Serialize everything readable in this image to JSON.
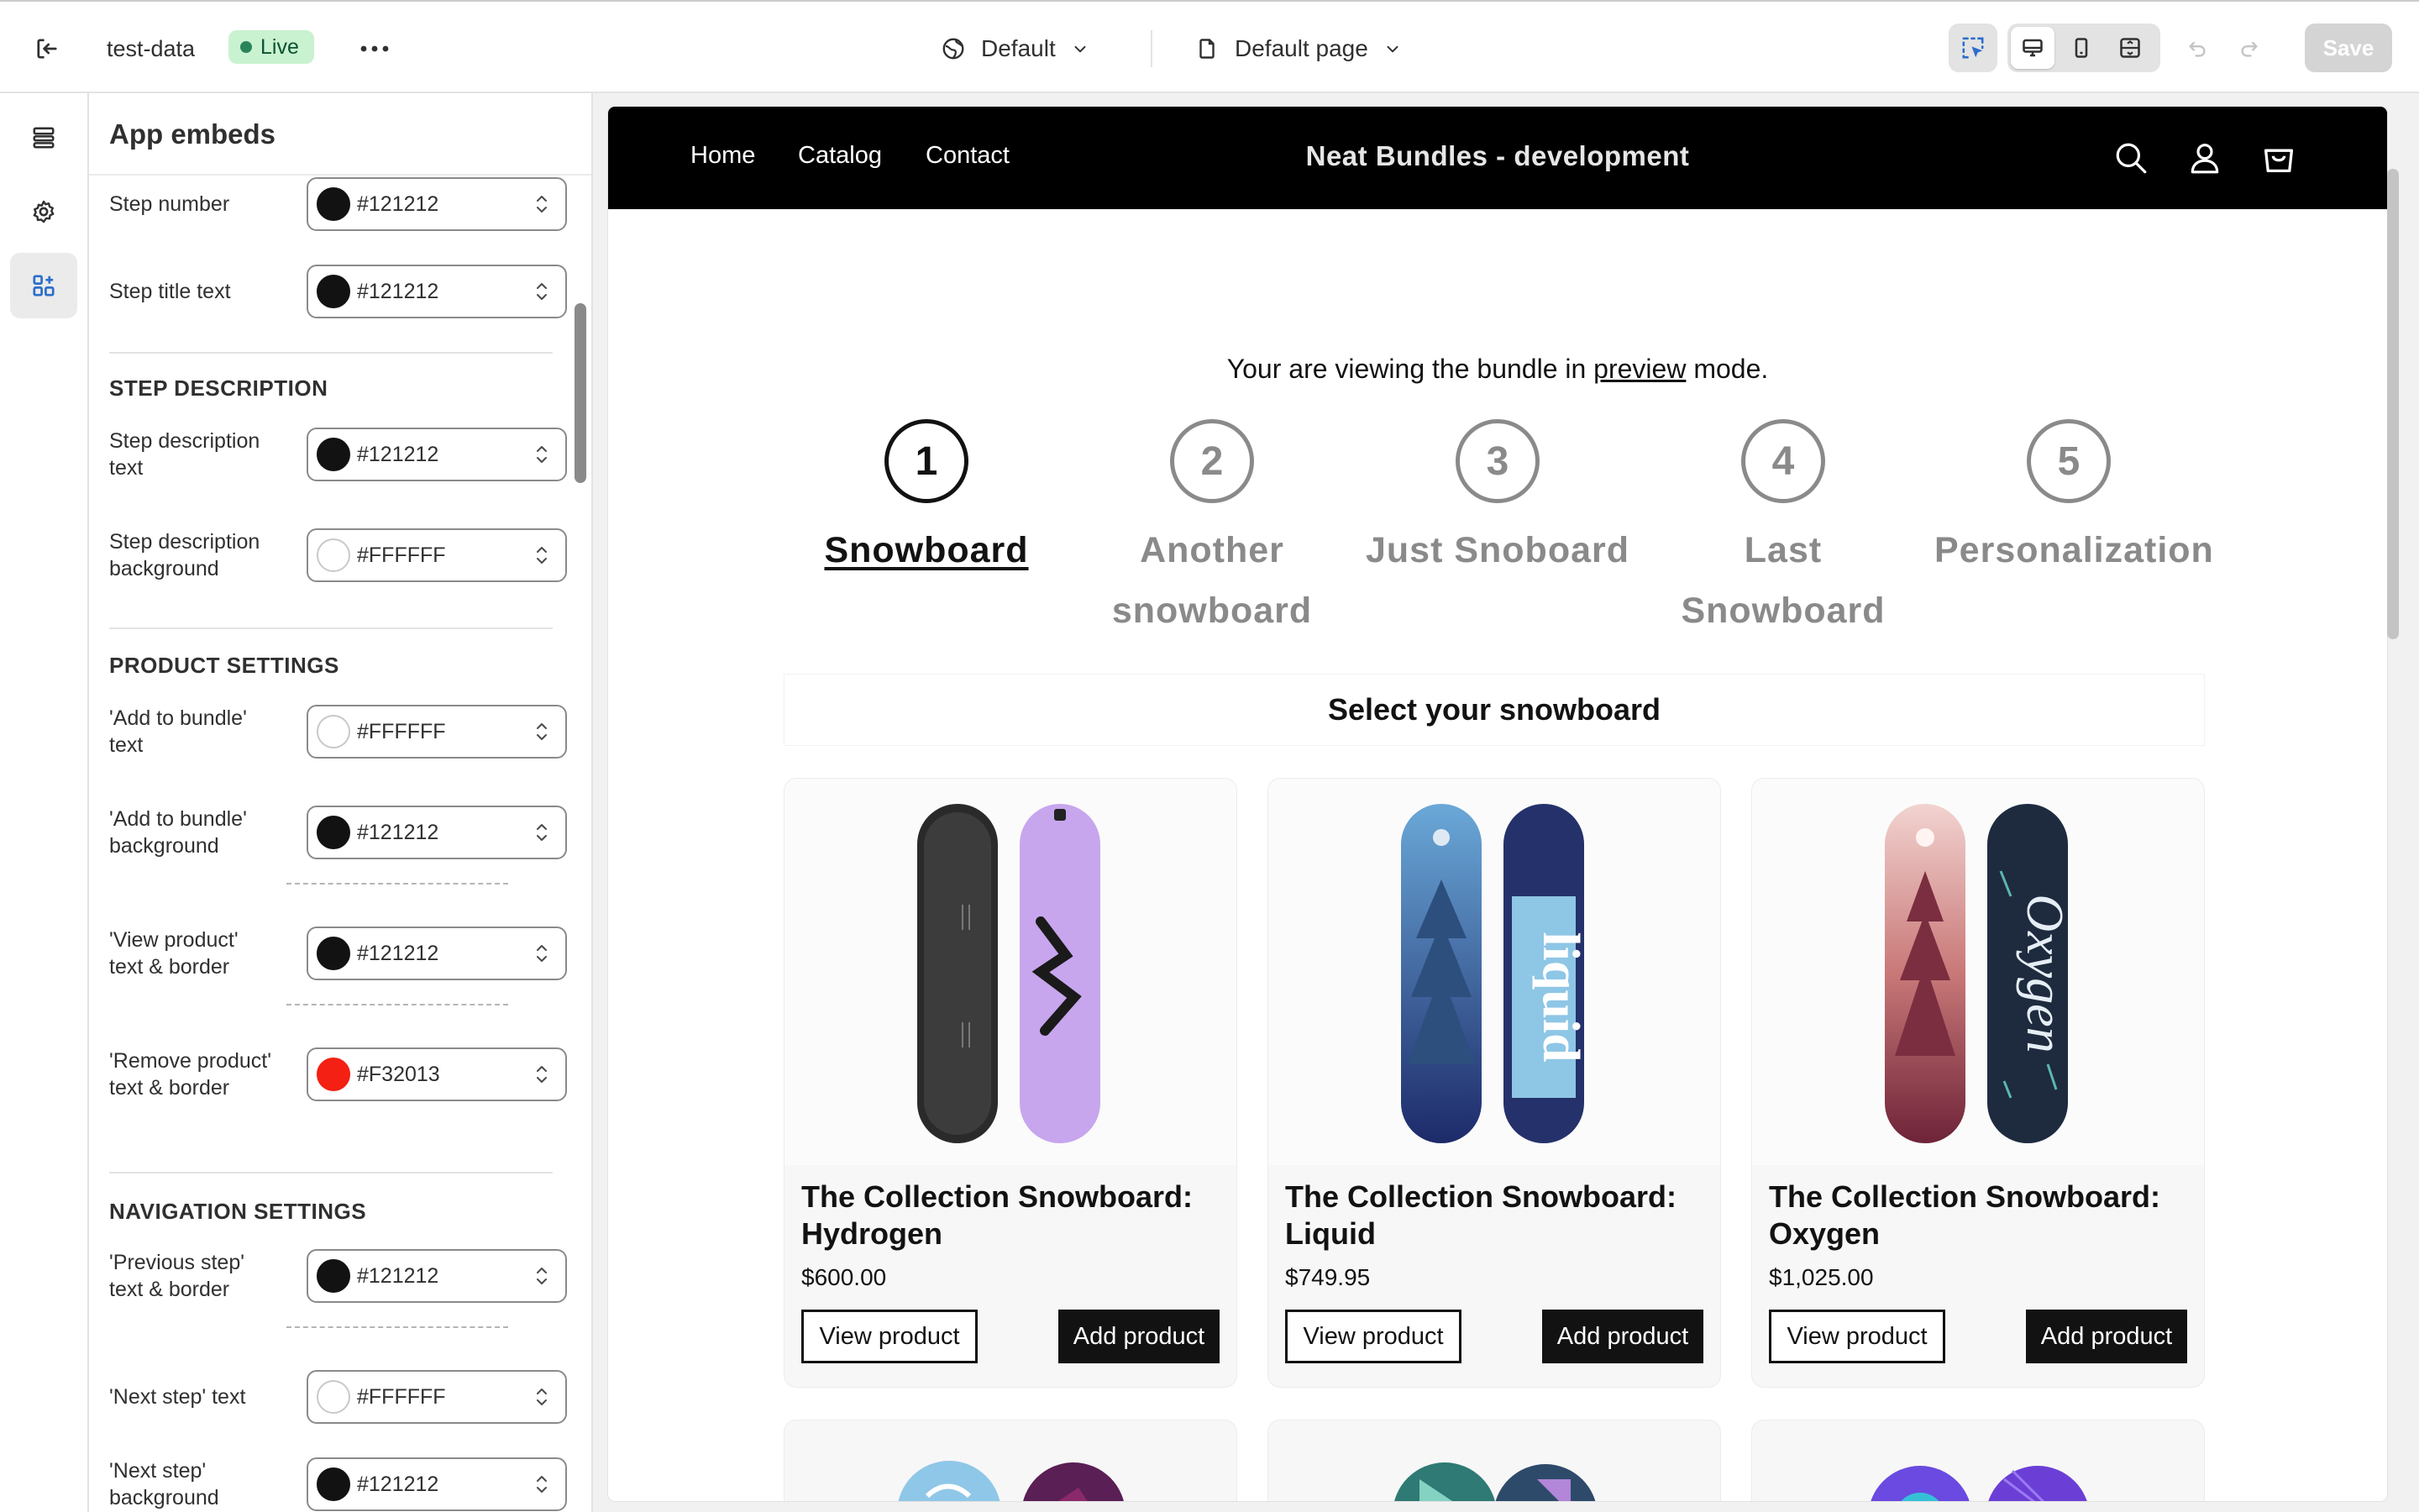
{
  "topbar": {
    "theme_name": "test-data",
    "status_badge": "Live",
    "more_label": "•••",
    "template_label": "Default",
    "page_label": "Default page",
    "save_label": "Save"
  },
  "panel": {
    "title": "App embeds",
    "settings": [
      {
        "label": "Step number",
        "hex": "#121212",
        "swatch": "#121212"
      },
      {
        "label": "Step title text",
        "hex": "#121212",
        "swatch": "#121212"
      },
      {
        "label": "Step description text",
        "hex": "#121212",
        "swatch": "#121212"
      },
      {
        "label": "Step description background",
        "hex": "#FFFFFF",
        "swatch": "#FFFFFF"
      },
      {
        "label": "'Add to bundle' text",
        "hex": "#FFFFFF",
        "swatch": "#FFFFFF"
      },
      {
        "label": "'Add to bundle' background",
        "hex": "#121212",
        "swatch": "#121212"
      },
      {
        "label": "'View product' text & border",
        "hex": "#121212",
        "swatch": "#121212"
      },
      {
        "label": "'Remove product' text & border",
        "hex": "#F32013",
        "swatch": "#F32013"
      },
      {
        "label": "'Previous step' text & border",
        "hex": "#121212",
        "swatch": "#121212"
      },
      {
        "label": "'Next step' text",
        "hex": "#FFFFFF",
        "swatch": "#FFFFFF"
      },
      {
        "label": "'Next step' background",
        "hex": "#121212",
        "swatch": "#121212"
      }
    ],
    "sections": {
      "step_description": "STEP DESCRIPTION",
      "product_settings": "PRODUCT SETTINGS",
      "navigation_settings": "NAVIGATION SETTINGS"
    }
  },
  "store": {
    "nav": [
      "Home",
      "Catalog",
      "Contact"
    ],
    "title": "Neat Bundles - development",
    "notice_before": "Your are viewing the bundle in ",
    "notice_link": "preview",
    "notice_after": " mode.",
    "steps": [
      {
        "number": "1",
        "line1": "Snowboard",
        "line2": ""
      },
      {
        "number": "2",
        "line1": "Another",
        "line2": "snowboard"
      },
      {
        "number": "3",
        "line1": "Just Snoboard",
        "line2": ""
      },
      {
        "number": "4",
        "line1": "Last",
        "line2": "Snowboard"
      },
      {
        "number": "5",
        "line1": "Personalization",
        "line2": ""
      }
    ],
    "select_heading": "Select your snowboard",
    "view_label": "View product",
    "add_label": "Add product",
    "products": [
      {
        "name": "The Collection Snowboard: Hydrogen",
        "price": "$600.00"
      },
      {
        "name": "The Collection Snowboard: Liquid",
        "price": "$749.95"
      },
      {
        "name": "The Collection Snowboard: Oxygen",
        "price": "$1,025.00"
      }
    ]
  },
  "icons": {
    "exit": "exit-icon",
    "template": "globe-icon",
    "page": "page-icon",
    "select_tool": "inspector-icon",
    "desktop": "desktop-icon",
    "mobile": "mobile-icon",
    "fullwidth": "fullscreen-icon",
    "undo": "undo-icon",
    "redo": "redo-icon",
    "sections": "sections-icon",
    "settings": "gear-icon",
    "apps": "app-embed-icon",
    "search": "search-icon",
    "account": "account-icon",
    "cart": "cart-icon"
  },
  "colors": {
    "accent": "#121212",
    "live_bg": "#c9f2d0",
    "live_dot": "#29845a",
    "remove": "#F32013"
  }
}
